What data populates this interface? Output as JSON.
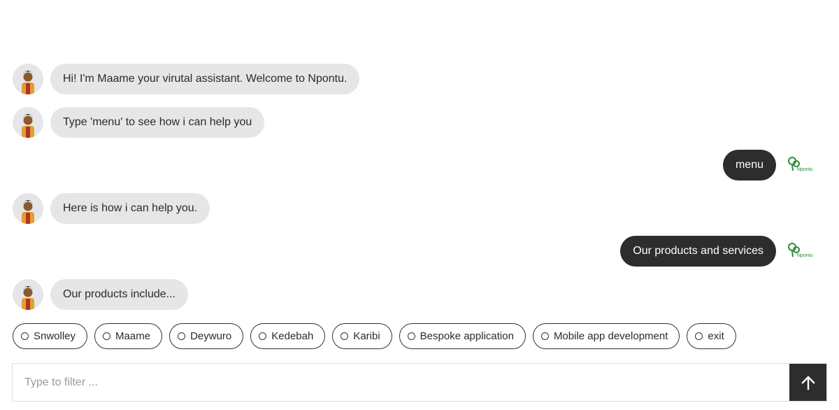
{
  "messages": [
    {
      "sender": "bot",
      "text": "Hi! I'm Maame your virutal assistant. Welcome to Npontu."
    },
    {
      "sender": "bot",
      "text": "Type 'menu' to see how i can help you"
    },
    {
      "sender": "user",
      "text": "menu"
    },
    {
      "sender": "bot",
      "text": "Here is how i can help you."
    },
    {
      "sender": "user",
      "text": "Our products and services"
    },
    {
      "sender": "bot",
      "text": "Our products include..."
    }
  ],
  "options": [
    "Snwolley",
    "Maame",
    "Deywuro",
    "Kedebah",
    "Karibi",
    "Bespoke application",
    "Mobile app development",
    "exit"
  ],
  "logo_text": "Npontu",
  "input": {
    "placeholder": "Type to filter ...",
    "value": ""
  },
  "icons": {
    "send": "arrow-up-icon",
    "bot_avatar": "assistant-avatar",
    "user_avatar": "npontu-logo"
  },
  "colors": {
    "bot_bubble": "#e6e6e9",
    "user_bubble": "#2d2d2d",
    "send_button": "#2d2d2d",
    "logo_green": "#2e8b3a"
  }
}
